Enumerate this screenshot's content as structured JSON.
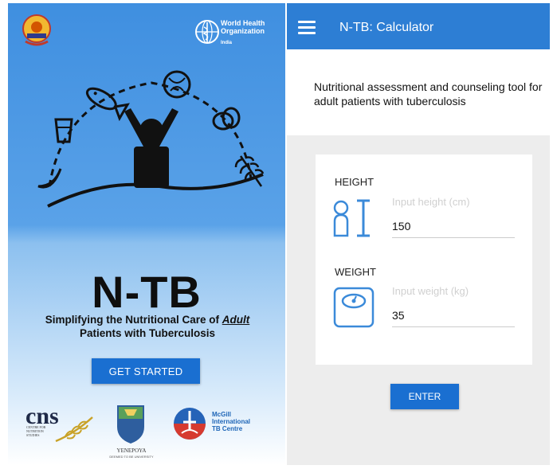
{
  "left_screen": {
    "who": {
      "name_line1": "World Health",
      "name_line2": "Organization",
      "region": "India"
    },
    "app_title": "N-TB",
    "tagline_part1": "Simplifying the Nutritional Care of ",
    "tagline_emphasis": "Adult",
    "tagline_part2": " Patients with Tuberculosis",
    "get_started_label": "GET STARTED",
    "partners": {
      "cns_name": "cns",
      "cns_subtitle": "CENTRE FOR NUTRITION STUDIES",
      "yenepoya_name": "YENEPOYA",
      "yenepoya_subtitle": "DEEMED TO BE UNIVERSITY",
      "mcgill_line1": "McGill",
      "mcgill_line2": "International",
      "mcgill_line3": "TB Centre"
    }
  },
  "right_screen": {
    "toolbar_title": "N-TB: Calculator",
    "intro": "Nutritional assessment and counseling tool for adult patients with tuberculosis",
    "height": {
      "label": "HEIGHT",
      "placeholder": "Input height (cm)",
      "value": "150"
    },
    "weight": {
      "label": "WEIGHT",
      "placeholder": "Input weight (kg)",
      "value": "35"
    },
    "enter_label": "ENTER"
  },
  "colors": {
    "toolbar": "#2d7ed4",
    "button": "#1a6fd1",
    "icon_blue": "#3b8ad9",
    "panel_bg": "#ededed"
  },
  "icons": {
    "menu": "hamburger-menu-icon",
    "height": "person-height-icon",
    "weight": "weighing-scale-icon"
  }
}
